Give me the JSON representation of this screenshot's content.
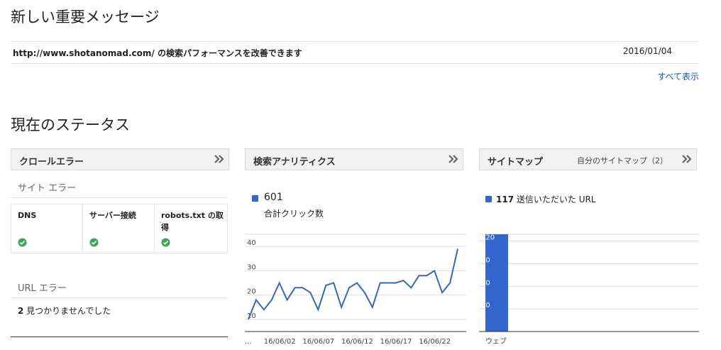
{
  "messages": {
    "title": "新しい重要メッセージ",
    "items": [
      {
        "text": "http://www.shotanomad.com/ の検索パフォーマンスを改善できます",
        "date": "2016/01/04"
      }
    ],
    "show_all": "すべて表示"
  },
  "status": {
    "title": "現在のステータス",
    "crawl_errors": {
      "title": "クロールエラー",
      "site_errors_label": "サイト エラー",
      "site_errors": [
        {
          "label": "DNS",
          "status_icon": "check-circle-icon"
        },
        {
          "label": "サーバー接続",
          "status_icon": "check-circle-icon"
        },
        {
          "label": "robots.txt の取得",
          "status_icon": "check-circle-icon"
        }
      ],
      "url_errors_label": "URL エラー",
      "url_errors_count": "2",
      "url_errors_text": " 見つかりませんでした"
    },
    "search_analytics": {
      "title": "検索アナリティクス",
      "total_value": "601",
      "total_label": "合計クリック数"
    },
    "sitemaps": {
      "title": "サイトマップ",
      "my_sitemaps": "自分のサイトマップ（2）",
      "stat_count": "117",
      "stat_label": " 送信いただいた URL"
    }
  },
  "colors": {
    "accent": "#3366cc",
    "ok": "#3aa757",
    "link": "#1155cc"
  },
  "chart_data": [
    {
      "type": "line",
      "series": [
        {
          "values": [
            10,
            18,
            14,
            18,
            25,
            18,
            23,
            23,
            21,
            14,
            24,
            25,
            15,
            23,
            25,
            21,
            15,
            25,
            25,
            25,
            26,
            23,
            28,
            28,
            30,
            21,
            25,
            39
          ]
        }
      ],
      "x_tick_labels": [
        "...",
        "16/06/02",
        "16/06/07",
        "16/06/12",
        "16/06/17",
        "16/06/22"
      ],
      "y_ticks": [
        10,
        20,
        30,
        40
      ],
      "ylim": [
        5,
        45
      ],
      "grid": true
    },
    {
      "type": "bar",
      "categories": [
        "ウェブ"
      ],
      "values": [
        129
      ],
      "y_ticks": [
        30,
        60,
        90,
        120
      ],
      "ylim": [
        0,
        129
      ],
      "grid": true
    }
  ]
}
